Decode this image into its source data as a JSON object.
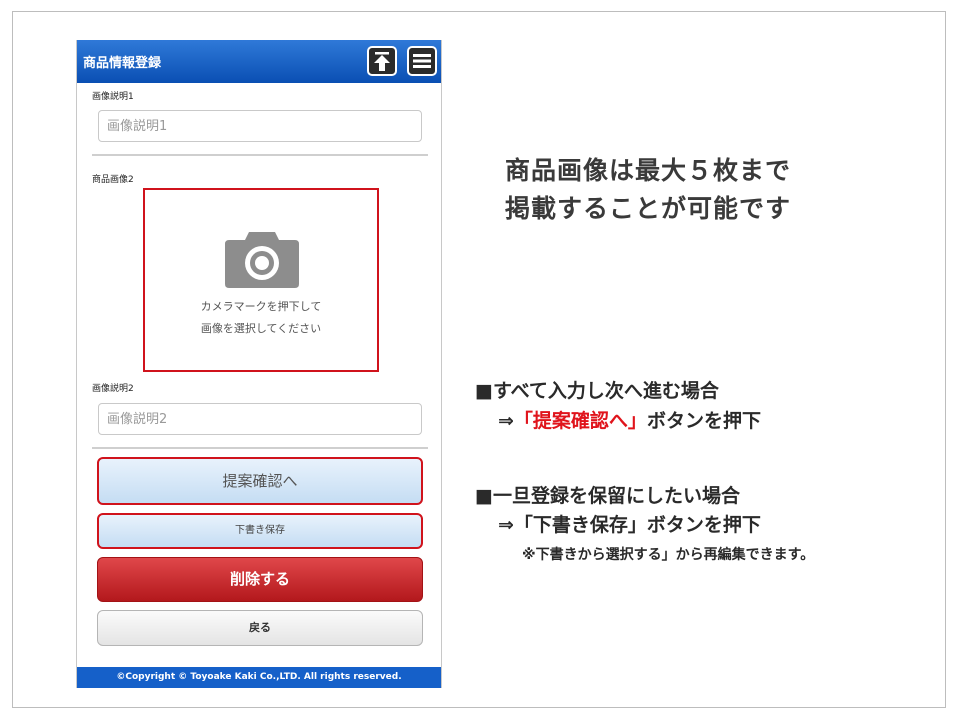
{
  "header": {
    "title": "商品情報登録",
    "up_icon": "arrow-up-to-top-icon",
    "menu_icon": "hamburger-menu-icon"
  },
  "form": {
    "desc1_label": "画像説明1",
    "desc1_placeholder": "画像説明1",
    "image2_label": "商品画像2",
    "camera_icon": "camera-icon",
    "camera_text_line1": "カメラマークを押下して",
    "camera_text_line2": "画像を選択してください",
    "desc2_label": "画像説明2",
    "desc2_placeholder": "画像説明2"
  },
  "buttons": {
    "confirm": "提案確認へ",
    "draft": "下書き保存",
    "delete": "削除する",
    "back": "戻る"
  },
  "footer": {
    "copyright": "©Copyright © Toyoake Kaki Co.,LTD. All rights reserved."
  },
  "annotations": {
    "headline_line1": "商品画像は最大５枚まで",
    "headline_line2": "掲載することが可能です",
    "note1_title": "■すべて入力し次へ進む場合",
    "note1_prefix": "⇒",
    "note1_highlight": "「提案確認へ」",
    "note1_suffix": "ボタンを押下",
    "note2_title": "■一旦登録を保留にしたい場合",
    "note2_line": "⇒「下書き保存」ボタンを押下",
    "note2_small": "※下書きから選択する」から再編集できます。"
  },
  "colors": {
    "header_blue": "#1560c9",
    "highlight_red": "#e0141c",
    "delete_red": "#c62a2e"
  }
}
